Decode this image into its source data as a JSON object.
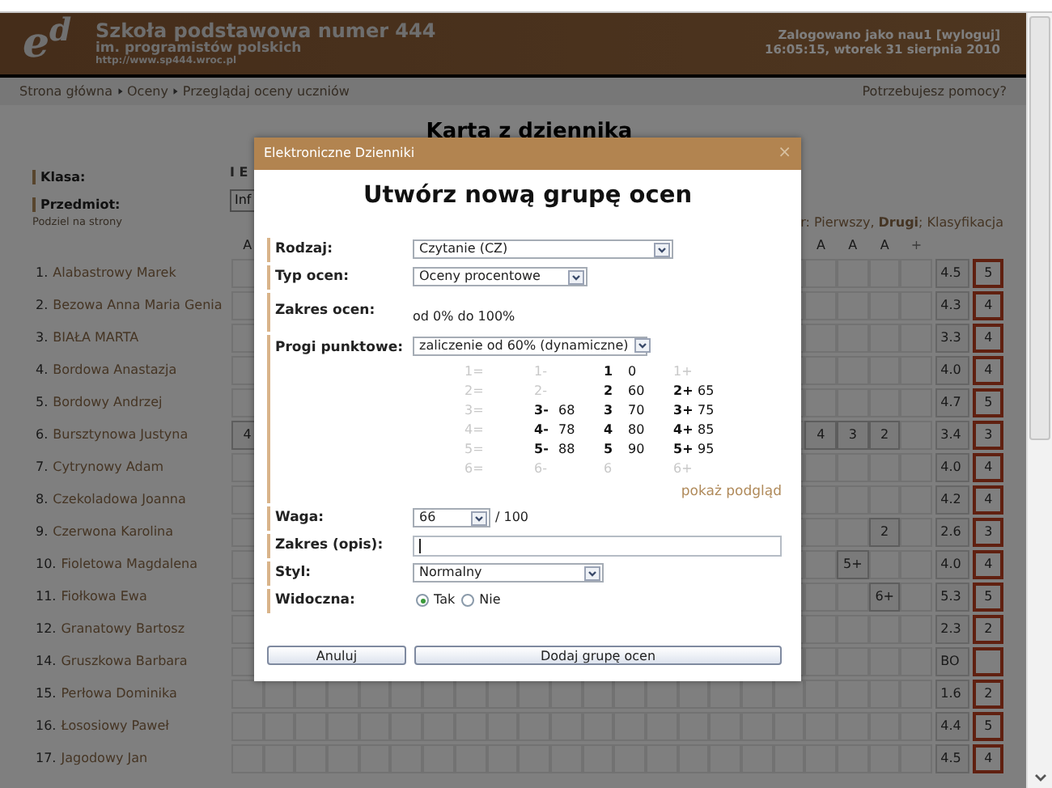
{
  "header": {
    "logo": "e$^{d}$",
    "school_name": "Szkoła podstawowa numer 444",
    "subtitle": "im. programistów polskich",
    "url": "http://www.sp444.wroc.pl",
    "login": "Zalogowano jako nau1 [wyloguj]",
    "datetime": "16:05:15, wtorek 31 sierpnia 2010"
  },
  "breadcrumb": {
    "items": [
      "Strona główna",
      "Oceny",
      "Przeglądaj oceny uczniów"
    ],
    "help": "Potrzebujesz pomocy?"
  },
  "page_title": "Karta z dziennika",
  "filters": [
    {
      "label": "Klasa:",
      "value": "I E",
      "kind": "text"
    },
    {
      "label": "Przedmiot:",
      "value": "Inf",
      "kind": "select"
    }
  ],
  "paging_link": "Podziel na strony",
  "semester_text": "r: Pierwszy, **Drugi**; Klasyfikacja",
  "table": {
    "grade_columns": [
      "A",
      "A",
      "A",
      "A",
      "+"
    ],
    "rows": [
      {
        "number": "1.",
        "name": "Alabastrowy Marek",
        "average": "4.5",
        "final": "5"
      },
      {
        "number": "2.",
        "name": "Bezowa Anna Maria Genia",
        "average": "4.3",
        "final": "4"
      },
      {
        "number": "3.",
        "name": "BIAŁA MARTA",
        "average": "3.3",
        "final": "4"
      },
      {
        "number": "4.",
        "name": "Bordowa Anastazja",
        "average": "4.0",
        "final": "4"
      },
      {
        "number": "5.",
        "name": "Bordowy Andrzej",
        "average": "4.7",
        "final": "5"
      },
      {
        "number": "6.",
        "name": "Bursztynowa Justyna",
        "grades": {
          "col_1": "4",
          "col_2": "4",
          "col_3": "3",
          "col_4": "2"
        },
        "average": "3.4",
        "final": "3"
      },
      {
        "number": "7.",
        "name": "Cytrynowy Adam",
        "average": "4.0",
        "final": "4"
      },
      {
        "number": "8.",
        "name": "Czekoladowa Joanna",
        "average": "4.2",
        "final": "4"
      },
      {
        "number": "9.",
        "name": "Czerwona Karolina",
        "grades": {
          "col_4": "2"
        },
        "average": "2.6",
        "final": "3"
      },
      {
        "number": "10.",
        "name": "Fioletowa Magdalena",
        "grades": {
          "col_3": "5+"
        },
        "average": "4.0",
        "final": "4"
      },
      {
        "number": "11.",
        "name": "Fiołkowa Ewa",
        "grades": {
          "col_4": "6+"
        },
        "average": "5.3",
        "final": "5"
      },
      {
        "number": "12.",
        "name": "Granatowy Bartosz",
        "average": "2.3",
        "final": "2"
      },
      {
        "number": "14.",
        "name": "Gruszkowa Barbara",
        "average": "BO"
      },
      {
        "number": "15.",
        "name": "Perłowa Dominika",
        "average": "1.6",
        "final": "2"
      },
      {
        "number": "16.",
        "name": "Łososiowy Paweł",
        "average": "4.4",
        "final": "5"
      },
      {
        "number": "17.",
        "name": "Jagodowy Jan",
        "average": "4.5",
        "final": "4"
      }
    ]
  },
  "dialog": {
    "title": "Elektroniczne Dzienniki",
    "close": "×",
    "heading": "Utwórz nową grupę ocen",
    "rows": [
      {
        "kind": "select",
        "label": "Rodzaj:",
        "value": "Czytanie (CZ)"
      },
      {
        "kind": "select",
        "label": "Typ ocen:",
        "value": "Oceny procentowe"
      },
      {
        "kind": "text",
        "label": "Zakres ocen:",
        "value": "od 0% do 100%"
      },
      {
        "kind": "thresholds",
        "label": "Progi punktowe:",
        "value": "zaliczenie od 60% (dynamiczne)",
        "link": "pokaż podgląd",
        "grid": [
          [
            {
              "grade": "1=",
              "active": false
            },
            {
              "grade": "1-",
              "active": false
            },
            {
              "grade": "1",
              "points": "0",
              "active": true
            },
            {
              "grade": "1+",
              "active": false
            }
          ],
          [
            {
              "grade": "2=",
              "active": false
            },
            {
              "grade": "2-",
              "active": false
            },
            {
              "grade": "2",
              "points": "60",
              "active": true
            },
            {
              "grade": "2+",
              "points": "65",
              "active": true
            }
          ],
          [
            {
              "grade": "3=",
              "active": false
            },
            {
              "grade": "3-",
              "points": "68",
              "active": true
            },
            {
              "grade": "3",
              "points": "70",
              "active": true
            },
            {
              "grade": "3+",
              "points": "75",
              "active": true
            }
          ],
          [
            {
              "grade": "4=",
              "active": false
            },
            {
              "grade": "4-",
              "points": "78",
              "active": true
            },
            {
              "grade": "4",
              "points": "80",
              "active": true
            },
            {
              "grade": "4+",
              "points": "85",
              "active": true
            }
          ],
          [
            {
              "grade": "5=",
              "active": false
            },
            {
              "grade": "5-",
              "points": "88",
              "active": true
            },
            {
              "grade": "5",
              "points": "90",
              "active": true
            },
            {
              "grade": "5+",
              "points": "95",
              "active": true
            }
          ],
          [
            {
              "grade": "6=",
              "active": false
            },
            {
              "grade": "6-",
              "active": false
            },
            {
              "grade": "6",
              "active": false
            },
            {
              "grade": "6+",
              "active": false
            }
          ]
        ]
      },
      {
        "kind": "select",
        "label": "Waga:",
        "value": "66",
        "suffix": "/ 100"
      },
      {
        "kind": "input",
        "label": "Zakres (opis):"
      },
      {
        "kind": "select",
        "label": "Styl:",
        "value": "Normalny"
      },
      {
        "kind": "radio",
        "label": "Widoczna:",
        "options": [
          {
            "label": "Tak",
            "selected": true
          },
          {
            "label": "Nie",
            "selected": false
          }
        ]
      }
    ],
    "buttons": [
      "Anuluj",
      "Dodaj grupę ocen"
    ]
  }
}
